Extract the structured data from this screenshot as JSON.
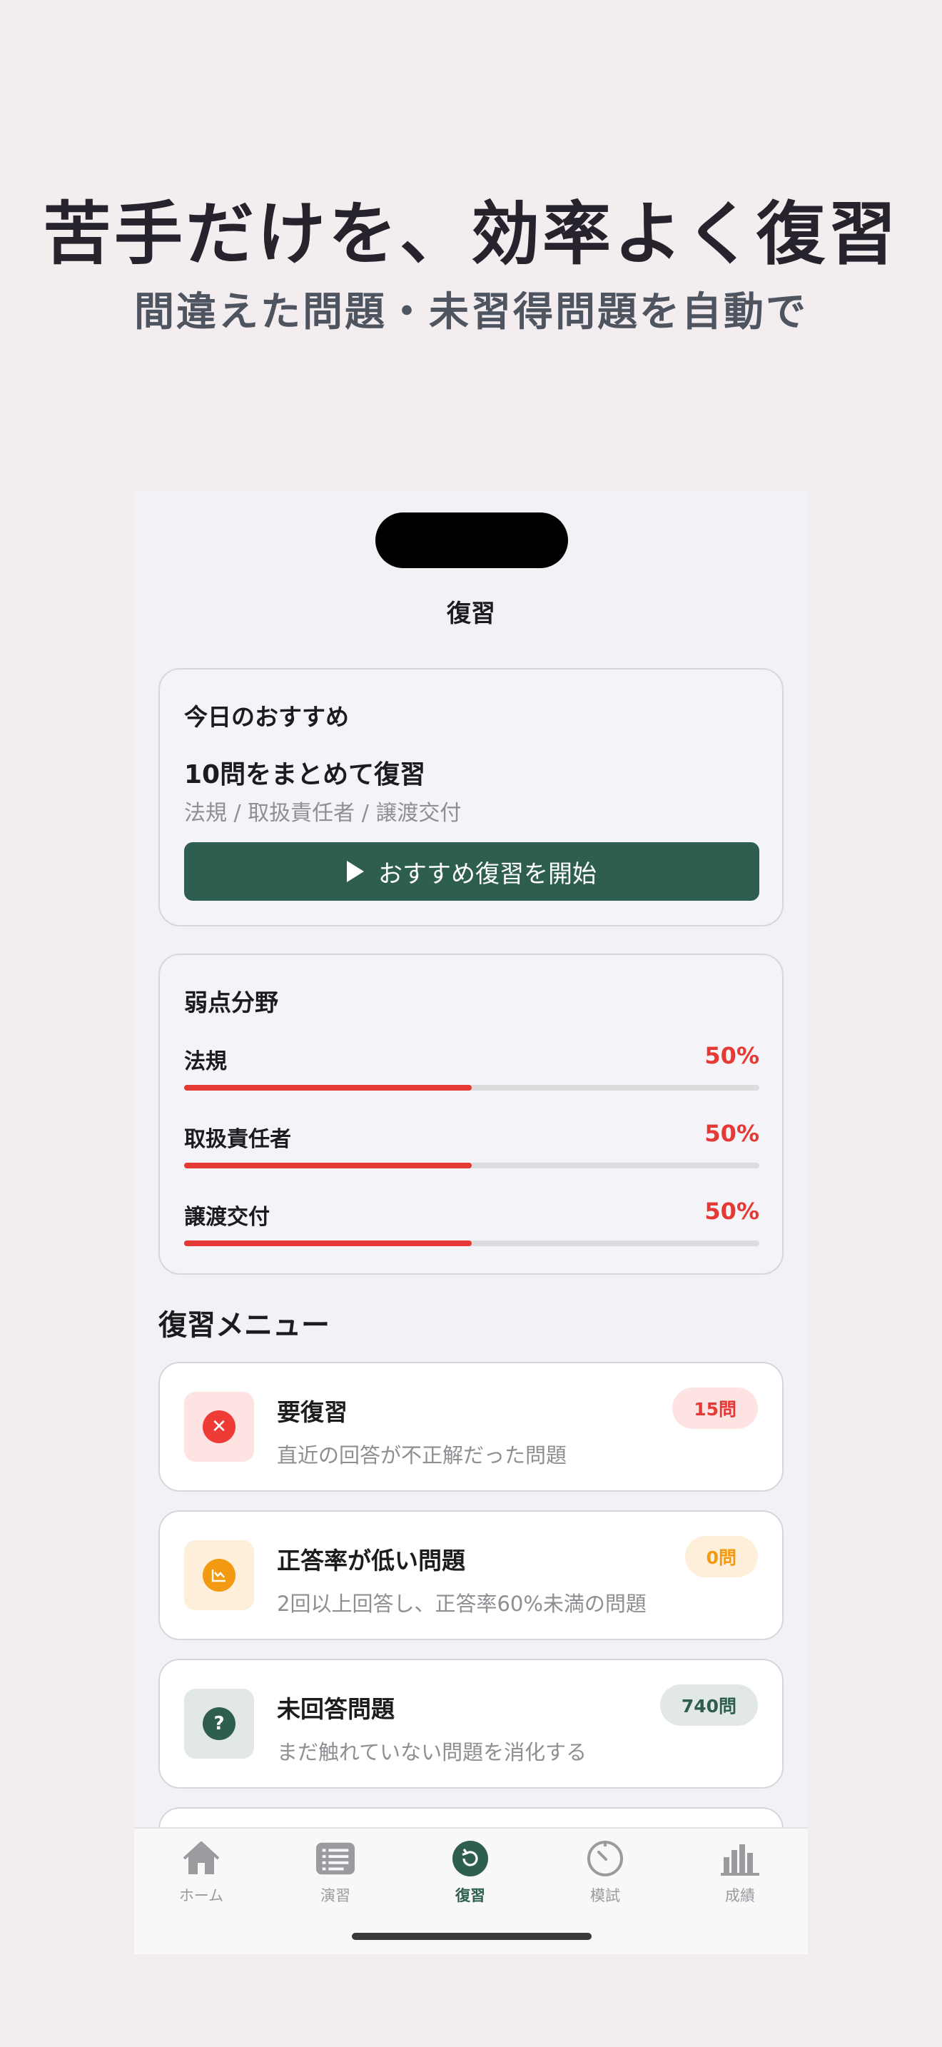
{
  "hero": {
    "headline": "苦手だけを、効率よく復習",
    "subheadline": "間違えた問題・未習得問題を自動で"
  },
  "screen": {
    "title": "復習"
  },
  "recommendation": {
    "label": "今日のおすすめ",
    "title": "10問をまとめて復習",
    "subtitle": "法規 / 取扱責任者 / 譲渡交付",
    "button_label": "おすすめ復習を開始"
  },
  "weak_areas": {
    "label": "弱点分野",
    "items": [
      {
        "name": "法規",
        "percent_label": "50%",
        "fraction": 0.5
      },
      {
        "name": "取扱責任者",
        "percent_label": "50%",
        "fraction": 0.5
      },
      {
        "name": "譲渡交付",
        "percent_label": "50%",
        "fraction": 0.5
      }
    ]
  },
  "review_menu": {
    "title": "復習メニュー",
    "items": [
      {
        "title": "要復習",
        "subtitle": "直近の回答が不正解だった問題",
        "badge": "15問",
        "icon": "x-circle-icon",
        "accent": "#ef3b36",
        "tint": "#fde4e2"
      },
      {
        "title": "正答率が低い問題",
        "subtitle": "2回以上回答し、正答率60%未満の問題",
        "badge": "0問",
        "icon": "chart-down-icon",
        "accent": "#f39a12",
        "tint": "#fdefd9"
      },
      {
        "title": "未回答問題",
        "subtitle": "まだ触れていない問題を消化する",
        "badge": "740問",
        "icon": "question-circle-icon",
        "accent": "#2e5e4f",
        "tint": "#e2e8e5"
      }
    ]
  },
  "tabs": [
    {
      "label": "ホーム",
      "icon": "house-icon",
      "active": false
    },
    {
      "label": "演習",
      "icon": "list-icon",
      "active": false
    },
    {
      "label": "復習",
      "icon": "review-icon",
      "active": true
    },
    {
      "label": "模試",
      "icon": "timer-icon",
      "active": false
    },
    {
      "label": "成績",
      "icon": "bar-chart-icon",
      "active": false
    }
  ],
  "colors": {
    "primary": "#2e5e4f",
    "danger": "#e53935",
    "background": "#f3edf0"
  }
}
